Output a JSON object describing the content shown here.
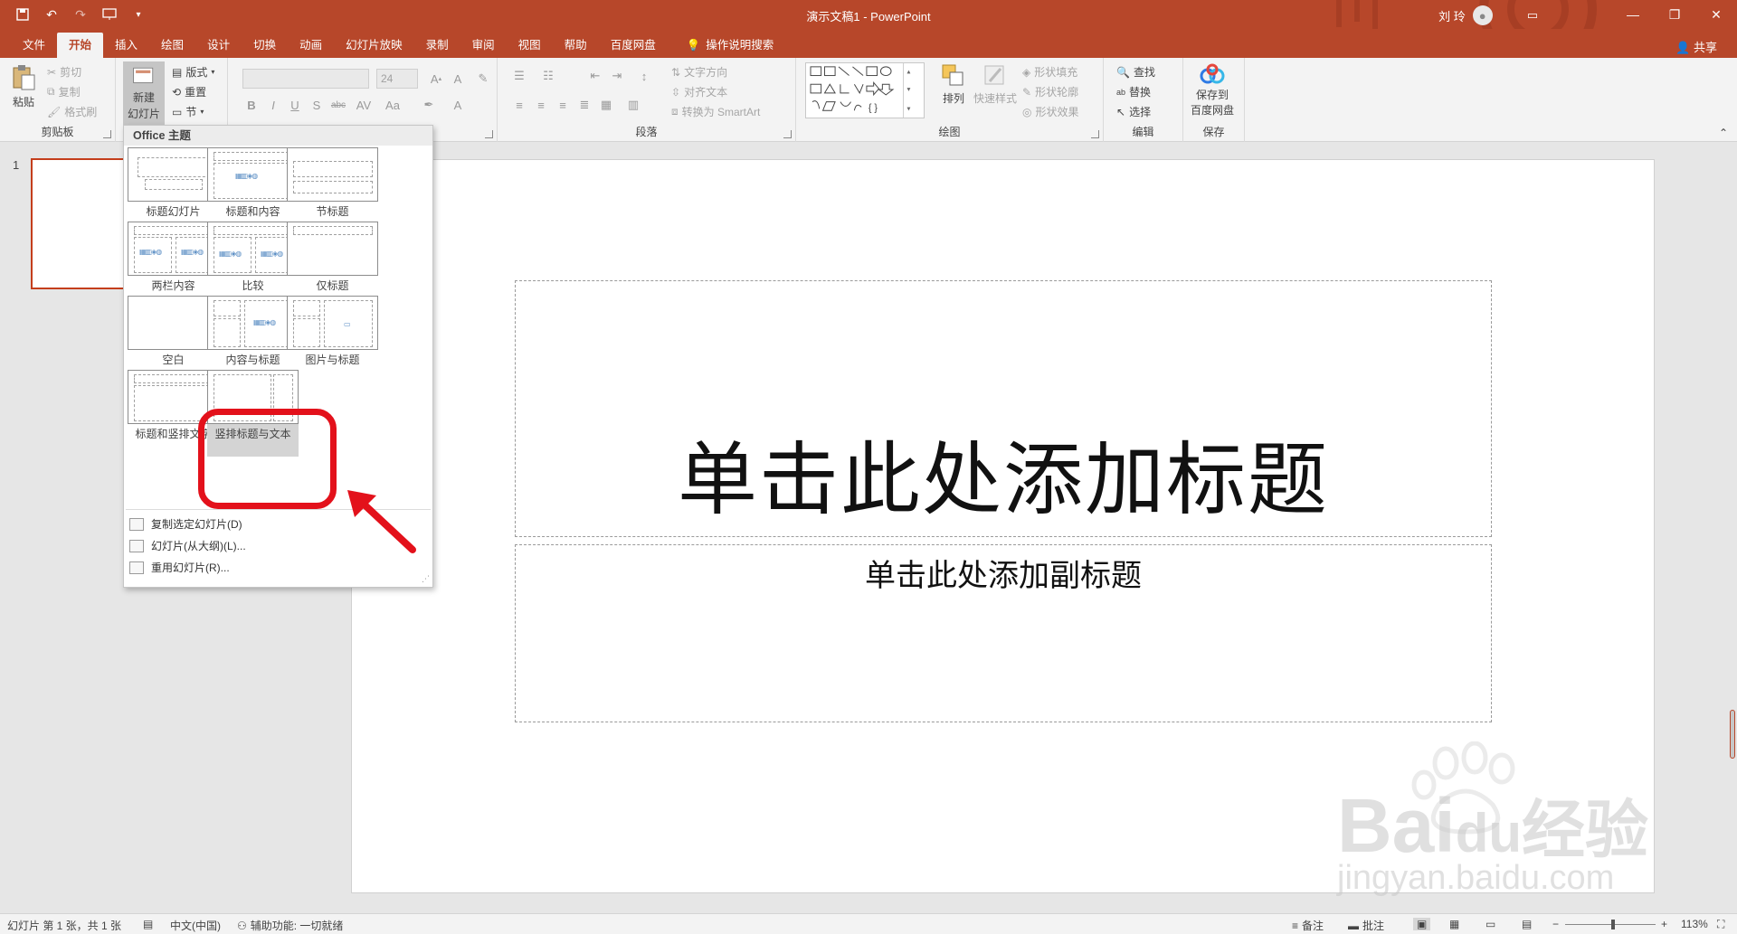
{
  "titlebar": {
    "title": "演示文稿1  -  PowerPoint",
    "user": "刘 玲",
    "qat_icons": [
      "save-icon",
      "undo-icon",
      "redo-icon",
      "start-from-beginning-icon",
      "customize-icon"
    ]
  },
  "tabs": [
    {
      "label": "文件",
      "active": false
    },
    {
      "label": "开始",
      "active": true
    },
    {
      "label": "插入",
      "active": false
    },
    {
      "label": "绘图",
      "active": false
    },
    {
      "label": "设计",
      "active": false
    },
    {
      "label": "切换",
      "active": false
    },
    {
      "label": "动画",
      "active": false
    },
    {
      "label": "幻灯片放映",
      "active": false
    },
    {
      "label": "录制",
      "active": false
    },
    {
      "label": "审阅",
      "active": false
    },
    {
      "label": "视图",
      "active": false
    },
    {
      "label": "帮助",
      "active": false
    },
    {
      "label": "百度网盘",
      "active": false
    }
  ],
  "tellme": "操作说明搜索",
  "share": "共享",
  "ribbon": {
    "clipboard": {
      "paste": "粘贴",
      "cut": "剪切",
      "copy": "复制",
      "format_painter": "格式刷",
      "label": "剪贴板"
    },
    "slides": {
      "new_slide_l1": "新建",
      "new_slide_l2": "幻灯片",
      "layout": "版式",
      "reset": "重置",
      "section": "节"
    },
    "font": {
      "size": "24"
    },
    "paragraph": {
      "text_direction": "文字方向",
      "align_text": "对齐文本",
      "smartart": "转换为 SmartArt",
      "label": "段落"
    },
    "drawing": {
      "arrange": "排列",
      "quick_styles": "快速样式",
      "shape_fill": "形状填充",
      "shape_outline": "形状轮廓",
      "shape_effects": "形状效果",
      "label": "绘图"
    },
    "editing": {
      "find": "查找",
      "replace": "替换",
      "select": "选择",
      "label": "编辑"
    },
    "save": {
      "l1": "保存到",
      "l2": "百度网盘",
      "label": "保存"
    }
  },
  "thumbnails": {
    "number": "1"
  },
  "slide": {
    "title_placeholder": "单击此处添加标题",
    "subtitle_placeholder": "单击此处添加副标题"
  },
  "layout_menu": {
    "header": "Office 主题",
    "layouts": [
      "标题幻灯片",
      "标题和内容",
      "节标题",
      "两栏内容",
      "比较",
      "仅标题",
      "空白",
      "内容与标题",
      "图片与标题",
      "标题和竖排文字",
      "竖排标题与文本"
    ],
    "selected": "竖排标题与文本",
    "actions": [
      "复制选定幻灯片(D)",
      "幻灯片(从大纲)(L)...",
      "重用幻灯片(R)..."
    ]
  },
  "watermark": {
    "brand": "Bai",
    "brand2": "du",
    "site_cn": "经验",
    "url": "jingyan.baidu.com"
  },
  "status": {
    "slide_info": "幻灯片 第 1 张，共 1 张",
    "language": "中文(中国)",
    "accessibility": "辅助功能: 一切就绪",
    "notes": "备注",
    "comments": "批注",
    "zoom": "113%"
  },
  "colors": {
    "accent": "#b7472a",
    "annotation": "#e3111b"
  }
}
